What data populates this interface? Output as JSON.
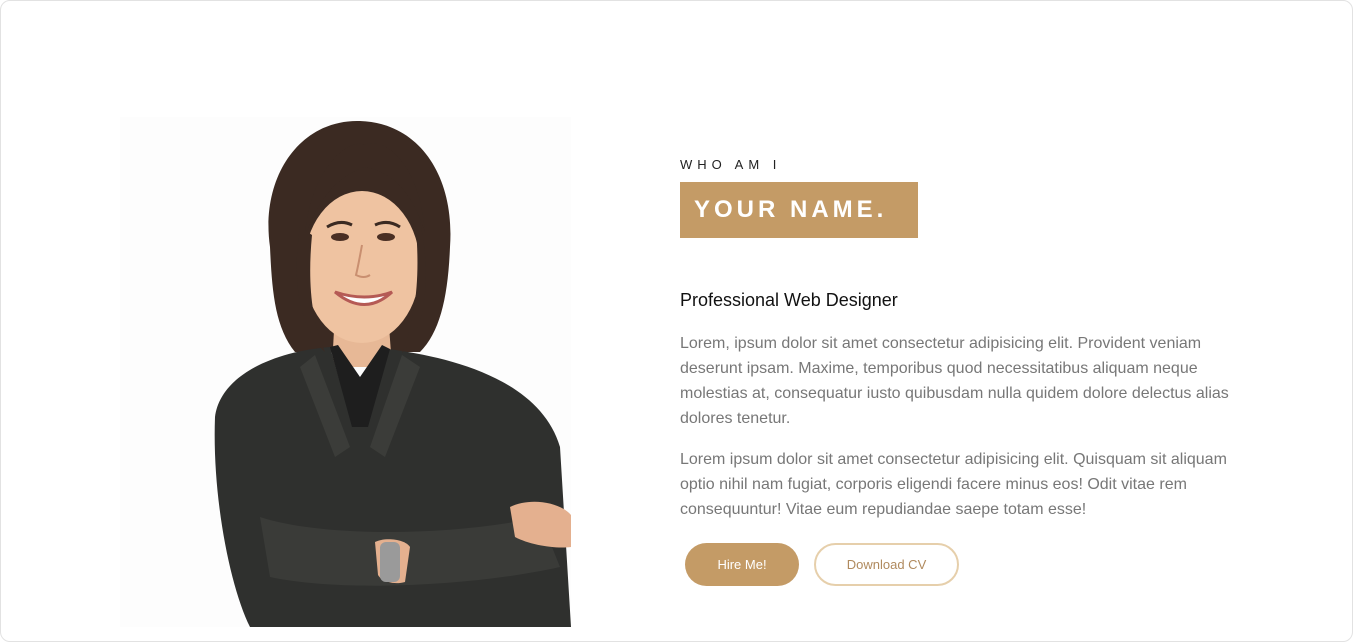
{
  "hero": {
    "eyebrow": "WHO AM I",
    "name": "YOUR NAME.",
    "role": "Professional Web Designer",
    "paragraphs": [
      "Lorem, ipsum dolor sit amet consectetur adipisicing elit. Provident veniam deserunt ipsam. Maxime, temporibus quod necessitatibus aliquam neque molestias at, consequatur iusto quibusdam nulla quidem dolore delectus alias dolores tenetur.",
      "Lorem ipsum dolor sit amet consectetur adipisicing elit. Quisquam sit aliquam optio nihil nam fugiat, corporis eligendi facere minus eos! Odit vitae rem consequuntur! Vitae eum repudiandae saepe totam esse!"
    ],
    "buttons": {
      "hire": "Hire Me!",
      "download": "Download CV"
    }
  },
  "colors": {
    "accent": "#c49b66",
    "accent_border": "#e6cfab",
    "body_text": "#777777"
  },
  "photo": {
    "subject": "portrait-woman-business-suit"
  }
}
